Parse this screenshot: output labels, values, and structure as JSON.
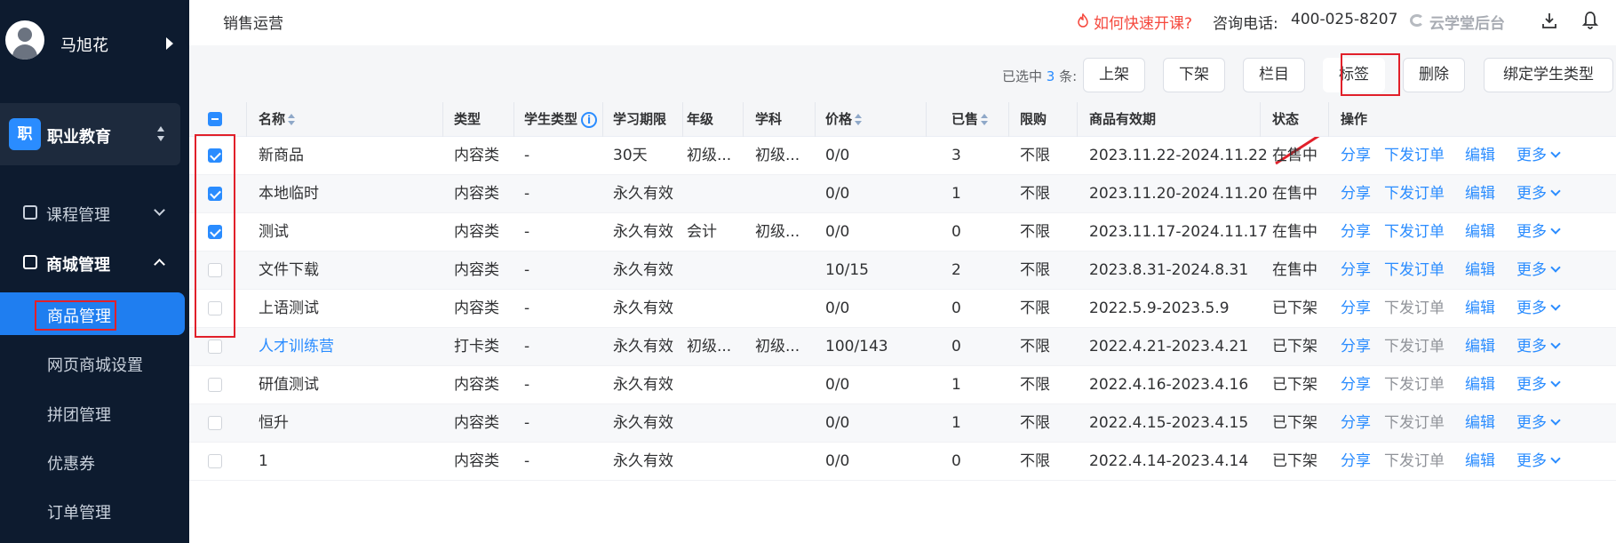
{
  "user": {
    "name": "马旭花"
  },
  "org": {
    "badge": "职",
    "name": "职业教育"
  },
  "menu": {
    "course": "课程管理",
    "mall": "商城管理",
    "sub": [
      "商品管理",
      "网页商城设置",
      "拼团管理",
      "优惠券",
      "订单管理"
    ]
  },
  "header": {
    "breadcrumb": "销售运营",
    "quick_start": "如何快速开课?",
    "hotline_label": "咨询电话:",
    "hotline_value": "400-025-8207",
    "brand": "云学堂后台"
  },
  "toolbar": {
    "selected_prefix": "已选中",
    "selected_count": "3",
    "selected_suffix": "条:",
    "buttons": [
      "上架",
      "下架",
      "栏目",
      "标签",
      "删除",
      "绑定学生类型"
    ]
  },
  "table": {
    "headers": [
      "名称",
      "类型",
      "学生类型",
      "学习期限",
      "年级",
      "学科",
      "价格",
      "已售",
      "限购",
      "商品有效期",
      "状态",
      "操作"
    ],
    "info_glyph": "i",
    "actions": {
      "share": "分享",
      "order": "下发订单",
      "edit": "编辑",
      "more": "更多"
    },
    "rows": [
      {
        "checked": true,
        "name": "新商品",
        "type": "内容类",
        "stype": "-",
        "term": "30天",
        "grade": "初级...",
        "subject": "初级...",
        "price": "0/0",
        "sold": "3",
        "limit": "不限",
        "valid": "2023.11.22-2024.11.22",
        "status": "在售中"
      },
      {
        "checked": true,
        "name": "本地临时",
        "type": "内容类",
        "stype": "-",
        "term": "永久有效",
        "grade": "",
        "subject": "",
        "price": "0/0",
        "sold": "1",
        "limit": "不限",
        "valid": "2023.11.20-2024.11.20",
        "status": "在售中"
      },
      {
        "checked": true,
        "name": "测试",
        "type": "内容类",
        "stype": "-",
        "term": "永久有效",
        "grade": "会计",
        "subject": "初级...",
        "price": "0/0",
        "sold": "0",
        "limit": "不限",
        "valid": "2023.11.17-2024.11.17",
        "status": "在售中"
      },
      {
        "checked": false,
        "name": "文件下载",
        "type": "内容类",
        "stype": "-",
        "term": "永久有效",
        "grade": "",
        "subject": "",
        "price": "10/15",
        "sold": "2",
        "limit": "不限",
        "valid": "2023.8.31-2024.8.31",
        "status": "在售中"
      },
      {
        "checked": false,
        "name": "上语测试",
        "type": "内容类",
        "stype": "-",
        "term": "永久有效",
        "grade": "",
        "subject": "",
        "price": "0/0",
        "sold": "0",
        "limit": "不限",
        "valid": "2022.5.9-2023.5.9",
        "status": "已下架"
      },
      {
        "checked": false,
        "name": "人才训练营",
        "type": "打卡类",
        "stype": "-",
        "term": "永久有效",
        "grade": "初级...",
        "subject": "初级...",
        "price": "100/143",
        "sold": "0",
        "limit": "不限",
        "valid": "2022.4.21-2023.4.21",
        "status": "已下架",
        "link": true
      },
      {
        "checked": false,
        "name": "研值测试",
        "type": "内容类",
        "stype": "-",
        "term": "永久有效",
        "grade": "",
        "subject": "",
        "price": "0/0",
        "sold": "1",
        "limit": "不限",
        "valid": "2022.4.16-2023.4.16",
        "status": "已下架"
      },
      {
        "checked": false,
        "name": "恒升",
        "type": "内容类",
        "stype": "-",
        "term": "永久有效",
        "grade": "",
        "subject": "",
        "price": "0/0",
        "sold": "1",
        "limit": "不限",
        "valid": "2022.4.15-2023.4.15",
        "status": "已下架"
      },
      {
        "checked": false,
        "name": "1",
        "type": "内容类",
        "stype": "-",
        "term": "永久有效",
        "grade": "",
        "subject": "",
        "price": "0/0",
        "sold": "0",
        "limit": "不限",
        "valid": "2022.4.14-2023.4.14",
        "status": "已下架"
      }
    ]
  },
  "colors": {
    "sidebar": "#0d1b2f",
    "accent": "#2a8cff",
    "annotation": "#e1202a"
  }
}
